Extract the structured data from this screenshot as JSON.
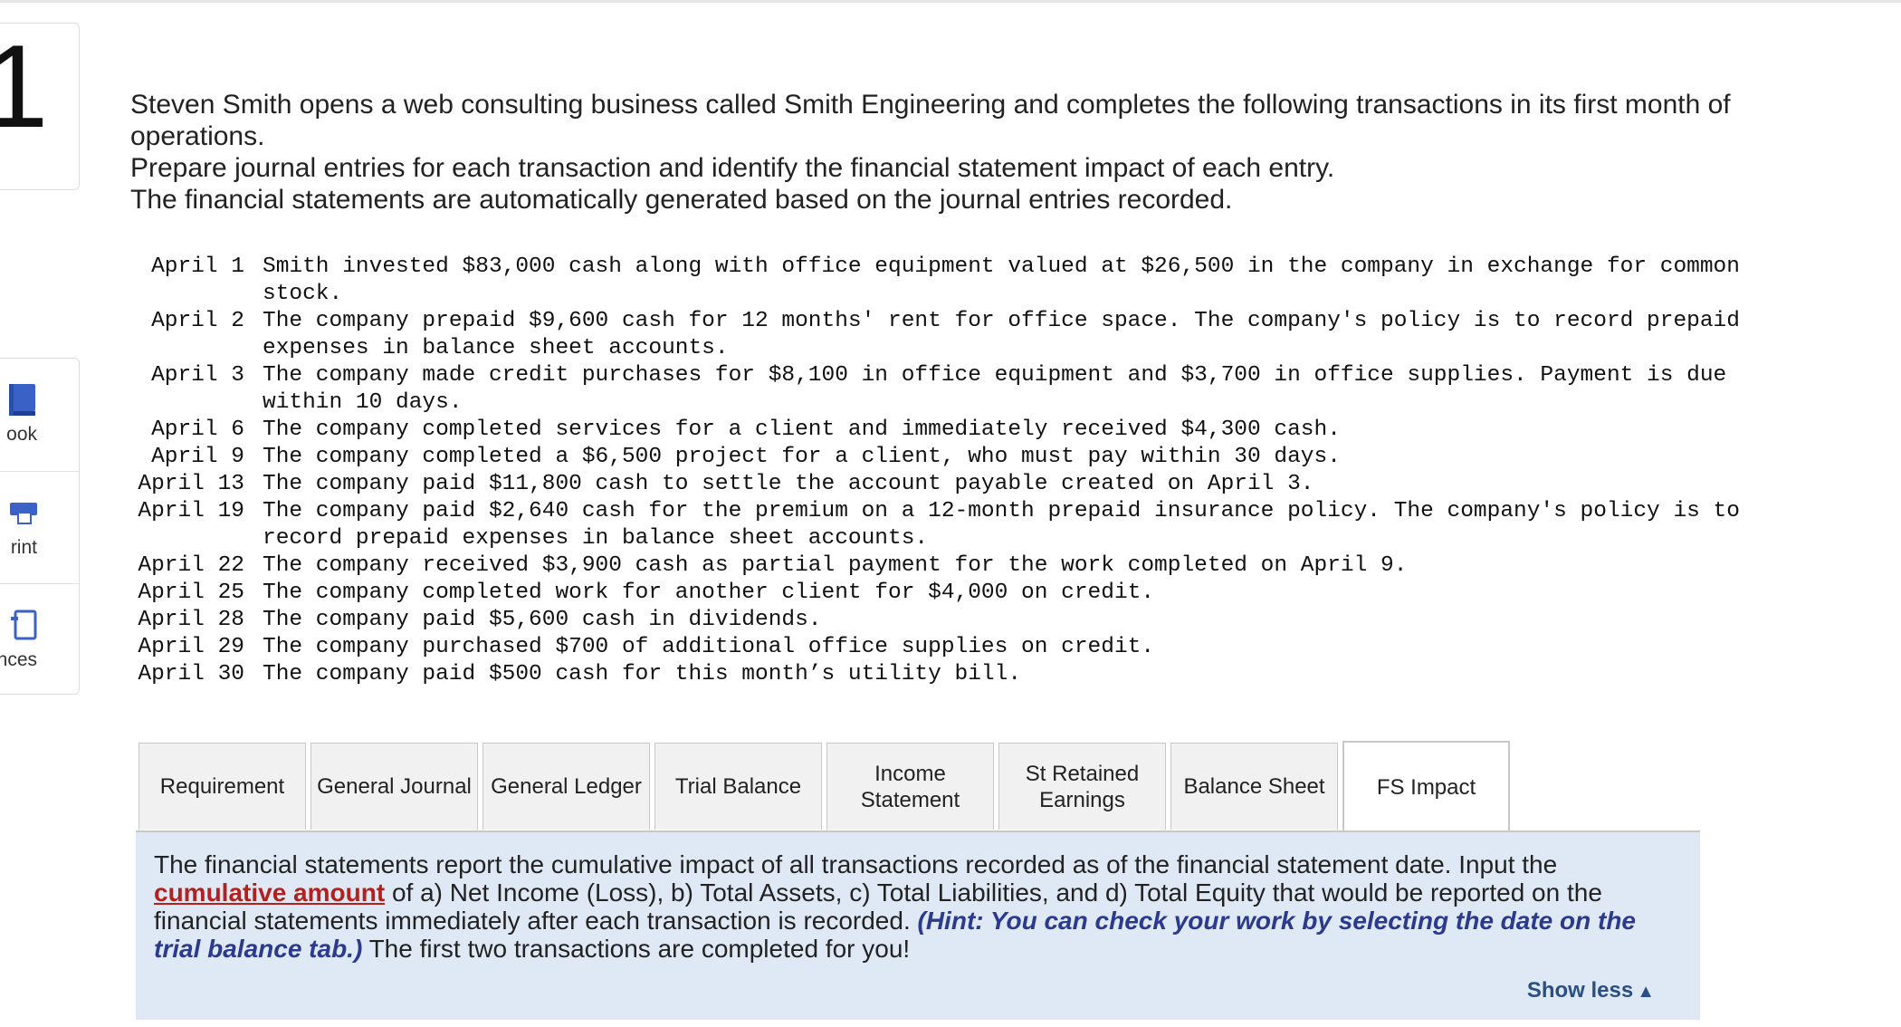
{
  "question": {
    "number": "1"
  },
  "tools": [
    {
      "label": "ook",
      "icon": "book-icon"
    },
    {
      "label": "rint",
      "icon": "print-icon"
    },
    {
      "label": "rences",
      "icon": "references-icon"
    }
  ],
  "intro": {
    "line1": "Steven Smith opens a web consulting business called Smith Engineering and completes the following transactions in its first month of operations.",
    "line2": "Prepare journal entries for each transaction and identify the financial statement impact of each entry.",
    "line3": "The financial statements are automatically generated based on the journal entries recorded."
  },
  "transactions": [
    {
      "date": "April 1",
      "text": "Smith invested $83,000 cash along with office equipment valued at $26,500 in the company in exchange for common stock."
    },
    {
      "date": "April 2",
      "text": "The company prepaid $9,600 cash for 12 months' rent for office space. The company's policy is to record prepaid expenses in balance sheet accounts."
    },
    {
      "date": "April 3",
      "text": "The company made credit purchases for $8,100 in office equipment and $3,700 in office supplies. Payment is due within 10 days."
    },
    {
      "date": "April 6",
      "text": "The company completed services for a client and immediately received $4,300 cash."
    },
    {
      "date": "April 9",
      "text": "The company completed a $6,500 project for a client, who must pay within 30 days."
    },
    {
      "date": "April 13",
      "text": "The company paid $11,800 cash to settle the account payable created on April 3."
    },
    {
      "date": "April 19",
      "text": "The company paid $2,640 cash for the premium on a 12-month prepaid insurance policy. The company's policy is to record prepaid expenses in balance sheet accounts."
    },
    {
      "date": "April 22",
      "text": "The company received $3,900 cash as partial payment for the work completed on April 9."
    },
    {
      "date": "April 25",
      "text": "The company completed work for another client for $4,000 on credit."
    },
    {
      "date": "April 28",
      "text": "The company paid $5,600 cash in dividends."
    },
    {
      "date": "April 29",
      "text": "The company purchased $700 of additional office supplies on credit."
    },
    {
      "date": "April 30",
      "text": "The company paid $500 cash for this month’s utility bill."
    }
  ],
  "tabs": [
    {
      "label": "Requirement",
      "active": false
    },
    {
      "label": "General Journal",
      "active": false
    },
    {
      "label": "General Ledger",
      "active": false
    },
    {
      "label": "Trial Balance",
      "active": false
    },
    {
      "label": "Income Statement",
      "active": false
    },
    {
      "label": "St Retained Earnings",
      "active": false
    },
    {
      "label": "Balance Sheet",
      "active": false
    },
    {
      "label": "FS Impact",
      "active": true
    }
  ],
  "panel": {
    "text_before": "The financial statements report the cumulative impact of all transactions recorded as of the financial statement date. Input the ",
    "link": "cumulative amount",
    "text_mid": " of a) Net Income (Loss), b) Total Assets, c) Total Liabilities, and d) Total Equity that would be reported on the financial statements immediately after each transaction is recorded. ",
    "hint": "(Hint: You can check your work by selecting the date on the trial balance tab.)",
    "text_after": " The first two transactions are completed for you!",
    "show_less": "Show less",
    "show_less_icon": "caret-up-icon"
  },
  "colors": {
    "panel_bg": "#dfe9f5",
    "link_red": "#b3211e",
    "hint_blue": "#2b3a8f",
    "icon_blue": "#3a62c6"
  }
}
